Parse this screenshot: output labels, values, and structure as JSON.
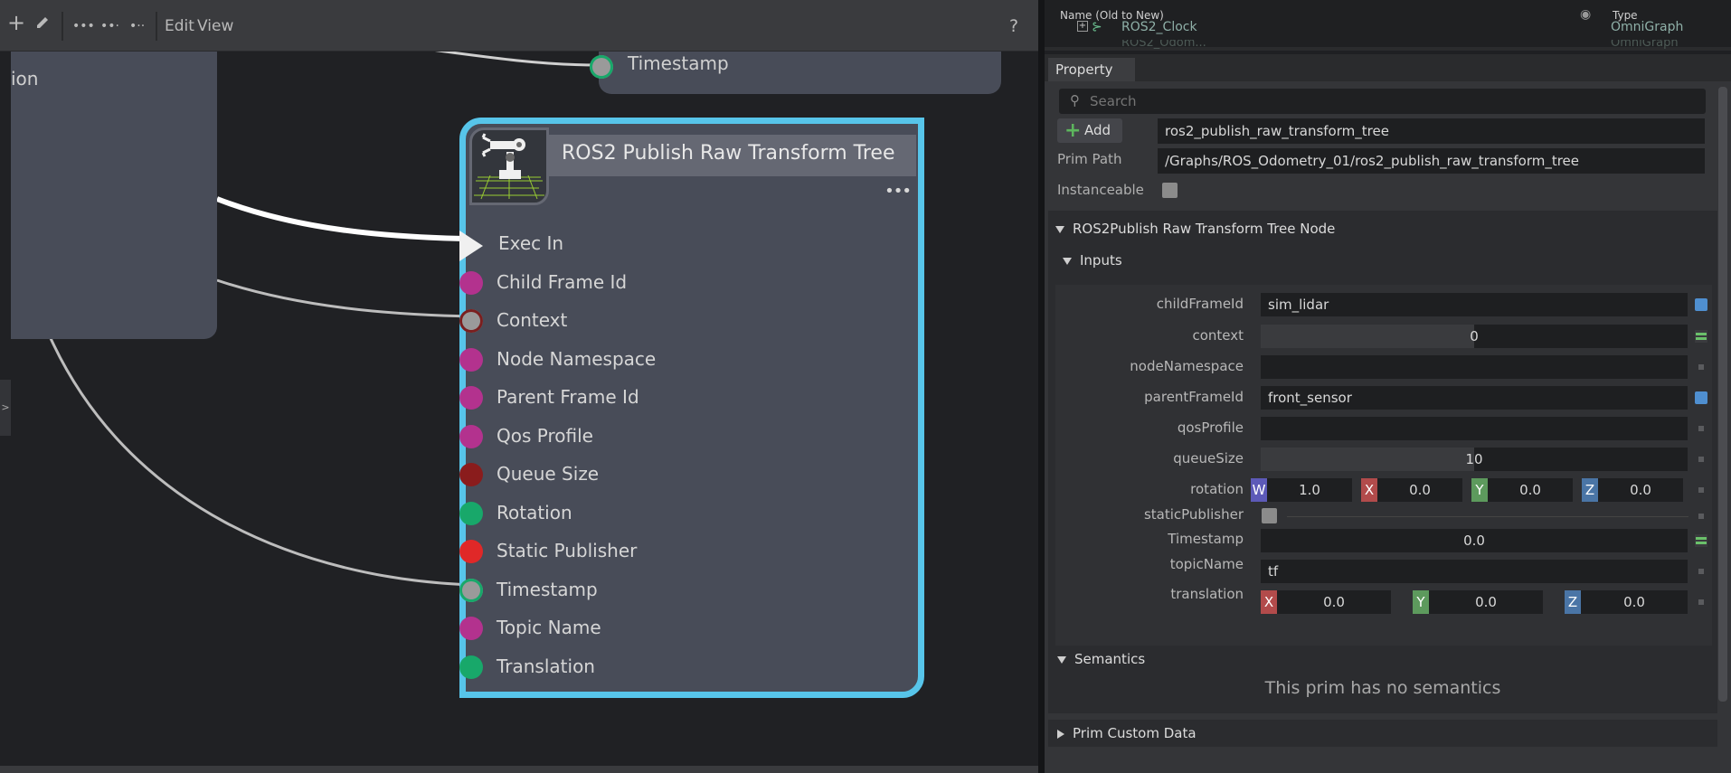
{
  "toolbar": {
    "edit_label": "Edit",
    "view_label": "View",
    "help_label": "?"
  },
  "graph": {
    "left_node_label": "ion",
    "top_node_port_label": "Timestamp",
    "side_toggle": ">",
    "node": {
      "title": "ROS2 Publish Raw Transform Tree",
      "dots": "•••",
      "ports": [
        {
          "label": "Exec In",
          "kind": "exec",
          "color": "#f0f0f0"
        },
        {
          "label": "Child Frame Id",
          "color": "#b3328e"
        },
        {
          "label": "Context",
          "color": "#9a9a9a",
          "ring": "#7a1f1f"
        },
        {
          "label": "Node Namespace",
          "color": "#b3328e"
        },
        {
          "label": "Parent Frame Id",
          "color": "#b3328e"
        },
        {
          "label": "Qos Profile",
          "color": "#b3328e"
        },
        {
          "label": "Queue Size",
          "color": "#8a1c1c"
        },
        {
          "label": "Rotation",
          "color": "#18a86a"
        },
        {
          "label": "Static Publisher",
          "color": "#e02828"
        },
        {
          "label": "Timestamp",
          "color": "#9a9a9a",
          "ring": "#18a86a"
        },
        {
          "label": "Topic Name",
          "color": "#b3328e"
        },
        {
          "label": "Translation",
          "color": "#18a86a"
        }
      ]
    }
  },
  "stage": {
    "col_name": "Name (Old to New)",
    "col_type": "Type",
    "row_name": "ROS2_Clock",
    "row_type": "OmniGraph",
    "row2_name": "ROS2_Odom...",
    "row2_type": "OmniGraph"
  },
  "property": {
    "tab_label": "Property",
    "search_placeholder": "Search",
    "add_label": "Add",
    "prim_name": "ros2_publish_raw_transform_tree",
    "prim_path_label": "Prim Path",
    "prim_path": "/Graphs/ROS_Odometry_01/ros2_publish_raw_transform_tree",
    "instanceable_label": "Instanceable",
    "node_section": "ROS2Publish Raw Transform Tree Node",
    "inputs_section": "Inputs",
    "inputs": {
      "childFrameId": {
        "label": "childFrameId",
        "value": "sim_lidar"
      },
      "context": {
        "label": "context",
        "value": "0"
      },
      "nodeNamespace": {
        "label": "nodeNamespace",
        "value": ""
      },
      "parentFrameId": {
        "label": "parentFrameId",
        "value": "front_sensor"
      },
      "qosProfile": {
        "label": "qosProfile",
        "value": ""
      },
      "queueSize": {
        "label": "queueSize",
        "value": "10"
      },
      "rotation": {
        "label": "rotation",
        "w": "1.0",
        "x": "0.0",
        "y": "0.0",
        "z": "0.0"
      },
      "staticPublisher": {
        "label": "staticPublisher"
      },
      "timestamp": {
        "label": "Timestamp",
        "value": "0.0"
      },
      "topicName": {
        "label": "topicName",
        "value": "tf"
      },
      "translation": {
        "label": "translation",
        "x": "0.0",
        "y": "0.0",
        "z": "0.0"
      }
    },
    "vec_tags": {
      "w": "W",
      "x": "X",
      "y": "Y",
      "z": "Z"
    },
    "semantics_section": "Semantics",
    "no_semantics": "This prim has no semantics",
    "custom_data_section": "Prim Custom Data"
  }
}
